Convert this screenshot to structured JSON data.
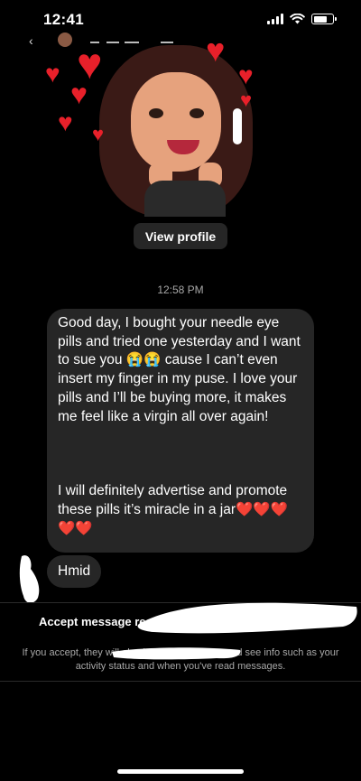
{
  "status_bar": {
    "time": "12:41",
    "signal_icon": "cellular-signal-icon",
    "wifi_icon": "wifi-icon",
    "battery_icon": "battery-icon",
    "battery_level": 0.7
  },
  "profile": {
    "view_profile_label": "View profile"
  },
  "conversation": {
    "timestamp": "12:58 PM",
    "messages": [
      {
        "paragraph1_a": "Good day, I bought your needle eye pills and tried one yesterday and I want to sue you ",
        "paragraph1_emoji": "😭😭",
        "paragraph1_b": " cause I can’t even insert my finger in my puse. I love your pills and I’ll be buying more, it makes me feel like a virgin all over again!",
        "paragraph2_a": "I will definitely advertise and promote these pills it’s miracle in a jar",
        "paragraph2_hearts": "❤️❤️❤️❤️❤️"
      },
      {
        "text": "Hmid"
      }
    ]
  },
  "request_panel": {
    "accept_title": "Accept message req",
    "info_text": "If you accept, they will also be able to call you and see info such as your activity status and when you've read messages."
  },
  "colors": {
    "background": "#000000",
    "bubble": "#262626",
    "heart_red": "#e8202a",
    "muted_text": "#a8a8a8"
  }
}
